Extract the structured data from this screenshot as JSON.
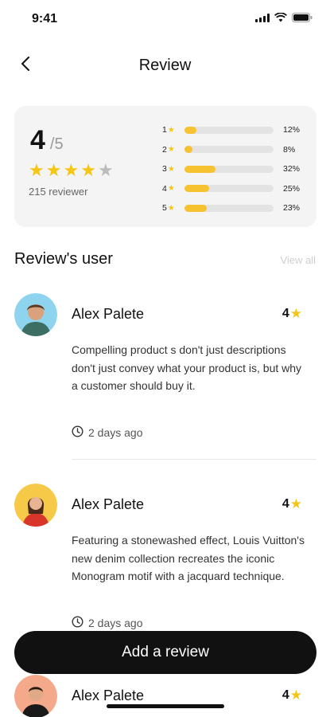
{
  "status_bar": {
    "time": "9:41"
  },
  "header": {
    "title": "Review",
    "back_icon": "chevron-left-icon"
  },
  "summary": {
    "score": "4",
    "score_max": "/5",
    "stars_filled": 4,
    "stars_total": 5,
    "reviewer_count": "215 reviewer",
    "distribution": [
      {
        "label": "1",
        "value": 12,
        "pct": "12%"
      },
      {
        "label": "2",
        "value": 8,
        "pct": "8%"
      },
      {
        "label": "3",
        "value": 32,
        "pct": "32%"
      },
      {
        "label": "4",
        "value": 25,
        "pct": "25%"
      },
      {
        "label": "5",
        "value": 23,
        "pct": "23%"
      }
    ]
  },
  "section": {
    "title": "Review's user",
    "view_all": "View all"
  },
  "reviews": [
    {
      "name": "Alex Palete",
      "rating": "4",
      "text": "Compelling product s don't just descriptions don't just convey what your product is, but why a customer should buy it.",
      "time": "2 days ago"
    },
    {
      "name": "Alex Palete",
      "rating": "4",
      "text": "Featuring a stonewashed effect, Louis Vuitton's new denim collection recreates the iconic Monogram motif with a jacquard technique.",
      "time": "2 days ago"
    },
    {
      "name": "Alex Palete",
      "rating": "4",
      "text": "",
      "time": ""
    }
  ],
  "cta": {
    "label": "Add a review"
  },
  "colors": {
    "accent": "#f6c230",
    "star": "#f5c518",
    "button": "#111111"
  }
}
